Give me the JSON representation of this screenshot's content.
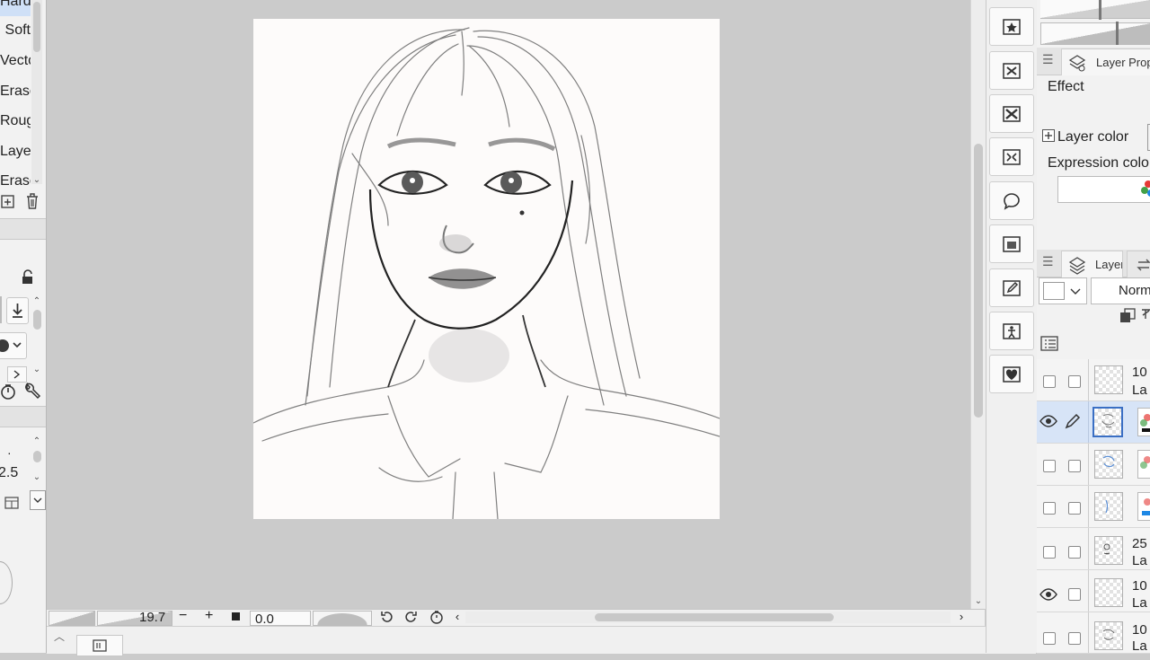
{
  "left_panel": {
    "subtools": [
      "Hard",
      "Soft",
      "Vector",
      "Eraser",
      "Rough",
      "Layers",
      "Eraser"
    ],
    "brush_size_value": "2.5",
    "icons": [
      "add-subtool-icon",
      "trash-icon",
      "lock-icon",
      "download-icon",
      "brush-tip-icon",
      "dial-icon",
      "wrench-icon",
      "layers-copy-icon"
    ]
  },
  "bottom_bar": {
    "zoom": "19.7",
    "minus": "−",
    "plus": "+",
    "rotation": "0.0"
  },
  "command_bar": {
    "icons": [
      "favorite-material-icon",
      "snap-icon",
      "clear-selection-icon",
      "transform-icon",
      "speech-balloon-icon",
      "image-material-icon",
      "edit-frame-icon",
      "figure-icon",
      "heart-icon"
    ]
  },
  "layer_property": {
    "tab_label": "Layer Prop",
    "effect_label": "Effect",
    "layer_color_label": "Layer color",
    "expression_color_label": "Expression colo"
  },
  "layer_panel": {
    "tab_label": "Layer",
    "blend_mode": "Norm",
    "layers": [
      {
        "line1": "10",
        "line2": "La",
        "visible": false,
        "selected": false
      },
      {
        "line1": "",
        "line2": "",
        "visible": true,
        "selected": true
      },
      {
        "line1": "",
        "line2": "",
        "visible": false,
        "selected": false
      },
      {
        "line1": "",
        "line2": "",
        "visible": false,
        "selected": false
      },
      {
        "line1": "25",
        "line2": "La",
        "visible": false,
        "selected": false
      },
      {
        "line1": "10",
        "line2": "La",
        "visible": true,
        "selected": false
      },
      {
        "line1": "10",
        "line2": "La",
        "visible": false,
        "selected": false
      }
    ]
  },
  "colors": {
    "canvas_bg": "#cbcbcb",
    "paper": "#fdfbfa",
    "panel_bg": "#f2f2f2",
    "selected_layer": "#d7e4f7",
    "accent_blue": "#3a6fc4"
  }
}
